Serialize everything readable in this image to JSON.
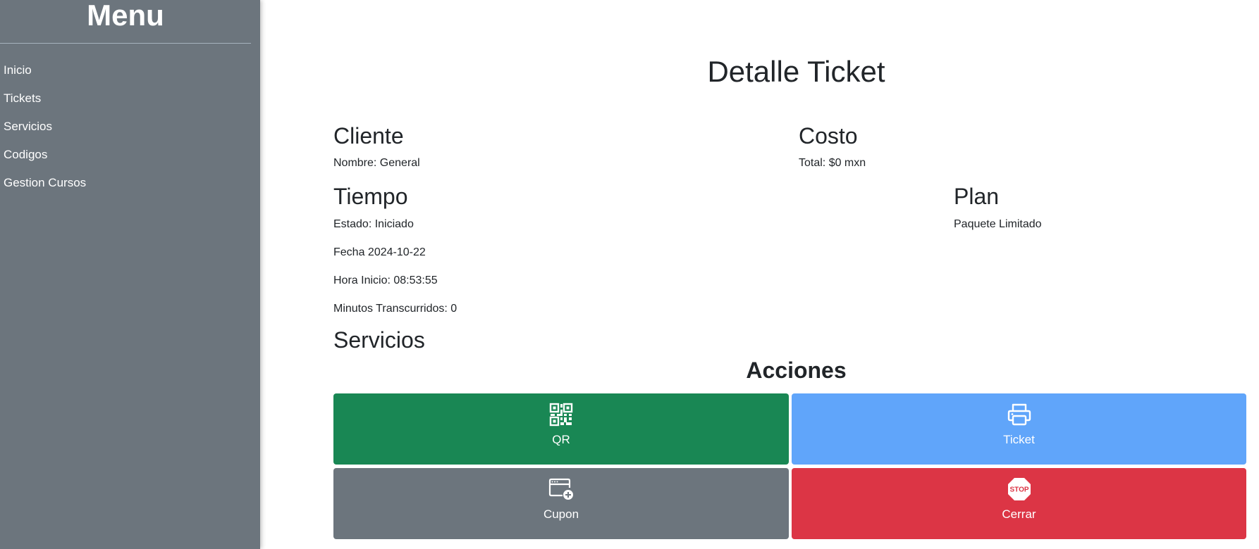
{
  "sidebar": {
    "title": "Menu",
    "items": [
      {
        "label": "Inicio"
      },
      {
        "label": "Tickets"
      },
      {
        "label": "Servicios"
      },
      {
        "label": "Codigos"
      },
      {
        "label": "Gestion Cursos"
      }
    ]
  },
  "main": {
    "title": "Detalle Ticket",
    "cliente": {
      "heading": "Cliente",
      "nombre": "Nombre: General"
    },
    "costo": {
      "heading": "Costo",
      "total": "Total: $0 mxn"
    },
    "tiempo": {
      "heading": "Tiempo",
      "estado": "Estado: Iniciado",
      "fecha": "Fecha 2024-10-22",
      "hora_inicio": "Hora Inicio: 08:53:55",
      "minutos": "Minutos Transcurridos: 0"
    },
    "plan": {
      "heading": "Plan",
      "nombre": "Paquete Limitado"
    },
    "servicios": {
      "heading": "Servicios"
    },
    "acciones": {
      "heading": "Acciones",
      "qr_label": "QR",
      "ticket_label": "Ticket",
      "cupon_label": "Cupon",
      "cerrar_label": "Cerrar",
      "stop_sign_text": "STOP"
    }
  },
  "colors": {
    "sidebar_bg": "#6c757d",
    "qr_button": "#198754",
    "ticket_button": "#60a5fa",
    "cupon_button": "#6c757d",
    "cerrar_button": "#dc3545"
  },
  "icons": [
    "qr-code-icon",
    "printer-icon",
    "window-plus-icon",
    "stop-sign-icon"
  ]
}
